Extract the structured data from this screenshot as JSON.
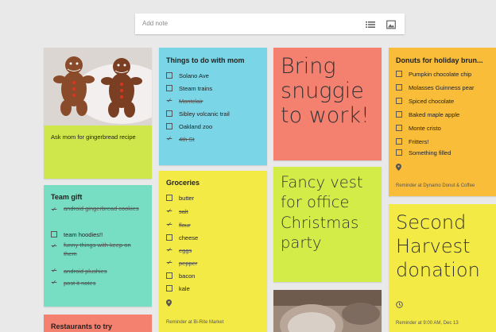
{
  "add_note": {
    "placeholder": "Add note",
    "list_icon": "list-icon",
    "image_icon": "image-icon"
  },
  "colors": {
    "green": "#cfe74a",
    "blue": "#7ad5e6",
    "red": "#f4806f",
    "orange": "#fabd39",
    "teal": "#78dec3",
    "yellow": "#f4ea46",
    "lime": "#d4ec48"
  },
  "notes": {
    "gingerbread": {
      "text": "Ask mom for gingerbread recipe"
    },
    "mom": {
      "title": "Things to do with mom",
      "items": [
        {
          "label": "Solano Ave",
          "done": false
        },
        {
          "label": "Steam trains",
          "done": false
        },
        {
          "label": "Montclair",
          "done": true
        },
        {
          "label": "Sibley volcanic trail",
          "done": false
        },
        {
          "label": "Oakland zoo",
          "done": false
        },
        {
          "label": "4th St",
          "done": true
        }
      ]
    },
    "snuggie": {
      "text": "Bring snuggie to work!"
    },
    "donuts": {
      "title": "Donuts for holiday brun...",
      "items": [
        {
          "label": "Pumpkin chocolate chip",
          "done": false
        },
        {
          "label": "Molasses Guinness pear",
          "done": false
        },
        {
          "label": "Spiced chocolate",
          "done": false
        },
        {
          "label": "Baked maple apple",
          "done": false
        },
        {
          "label": "Monte cristo",
          "done": false
        },
        {
          "label": "Fritters!",
          "done": false
        },
        {
          "label": "Something filled",
          "done": false
        }
      ],
      "reminder": "Reminder at Dynamo Donut & Coffee"
    },
    "team": {
      "title": "Team gift",
      "items": [
        {
          "label": "android gingerbread cookies",
          "done": true
        },
        {
          "label": "team hoodies!!",
          "done": false
        },
        {
          "label": "funny things with keep on them",
          "done": true
        },
        {
          "label": "android plushies",
          "done": true
        },
        {
          "label": "post it notes",
          "done": true
        }
      ]
    },
    "groceries": {
      "title": "Groceries",
      "items": [
        {
          "label": "butter",
          "done": false
        },
        {
          "label": "salt",
          "done": true
        },
        {
          "label": "flour",
          "done": true
        },
        {
          "label": "cheese",
          "done": false
        },
        {
          "label": "eggs",
          "done": true
        },
        {
          "label": "pepper",
          "done": true
        },
        {
          "label": "bacon",
          "done": false
        },
        {
          "label": "kale",
          "done": false
        }
      ],
      "reminder": "Reminder at Bi-Rite Market"
    },
    "vest": {
      "text": "Fancy vest for office Christmas party"
    },
    "harvest": {
      "text": "Second Harvest donation",
      "reminder": "Reminder at 9:00 AM, Dec 13"
    },
    "restaurants": {
      "title": "Restaurants to try"
    }
  }
}
